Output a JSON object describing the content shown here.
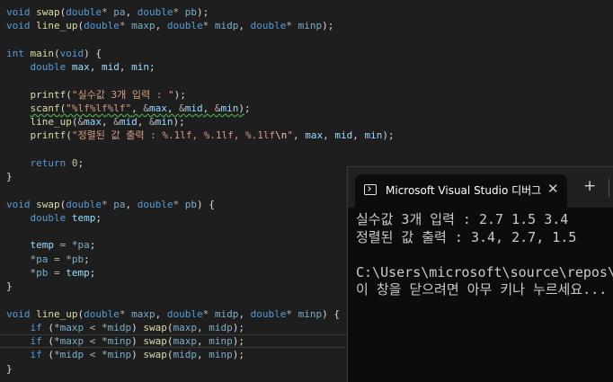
{
  "editor": {
    "lines": [
      {
        "current": false,
        "tokens": [
          [
            "kw",
            "void"
          ],
          [
            "pu",
            " "
          ],
          [
            "fn",
            "swap"
          ],
          [
            "pu",
            "("
          ],
          [
            "ty",
            "double"
          ],
          [
            "op",
            "*"
          ],
          [
            "pu",
            " "
          ],
          [
            "pm",
            "pa"
          ],
          [
            "pu",
            ", "
          ],
          [
            "ty",
            "double"
          ],
          [
            "op",
            "*"
          ],
          [
            "pu",
            " "
          ],
          [
            "pm",
            "pb"
          ],
          [
            "pu",
            ");"
          ]
        ]
      },
      {
        "current": false,
        "tokens": [
          [
            "kw",
            "void"
          ],
          [
            "pu",
            " "
          ],
          [
            "fn",
            "line_up"
          ],
          [
            "pu",
            "("
          ],
          [
            "ty",
            "double"
          ],
          [
            "op",
            "*"
          ],
          [
            "pu",
            " "
          ],
          [
            "pm",
            "maxp"
          ],
          [
            "pu",
            ", "
          ],
          [
            "ty",
            "double"
          ],
          [
            "op",
            "*"
          ],
          [
            "pu",
            " "
          ],
          [
            "pm",
            "midp"
          ],
          [
            "pu",
            ", "
          ],
          [
            "ty",
            "double"
          ],
          [
            "op",
            "*"
          ],
          [
            "pu",
            " "
          ],
          [
            "pm",
            "minp"
          ],
          [
            "pu",
            ");"
          ]
        ]
      },
      {
        "current": false,
        "tokens": []
      },
      {
        "current": false,
        "tokens": [
          [
            "kw",
            "int"
          ],
          [
            "pu",
            " "
          ],
          [
            "fn",
            "main"
          ],
          [
            "pu",
            "("
          ],
          [
            "kw",
            "void"
          ],
          [
            "pu",
            ") {"
          ]
        ]
      },
      {
        "current": false,
        "tokens": [
          [
            "pu",
            "    "
          ],
          [
            "ty",
            "double"
          ],
          [
            "pu",
            " "
          ],
          [
            "lv",
            "max"
          ],
          [
            "pu",
            ", "
          ],
          [
            "lv",
            "mid"
          ],
          [
            "pu",
            ", "
          ],
          [
            "lv",
            "min"
          ],
          [
            "pu",
            ";"
          ]
        ]
      },
      {
        "current": false,
        "tokens": []
      },
      {
        "current": false,
        "tokens": [
          [
            "pu",
            "    "
          ],
          [
            "fn",
            "printf"
          ],
          [
            "pu",
            "("
          ],
          [
            "str",
            "\"실수값 3개 입력 : \""
          ],
          [
            "pu",
            ");"
          ]
        ]
      },
      {
        "current": false,
        "tokens": [
          [
            "pu",
            "    "
          ],
          [
            "fn squig",
            "scanf"
          ],
          [
            "pu squig",
            "("
          ],
          [
            "str squig",
            "\"%lf%lf%lf\""
          ],
          [
            "pu squig",
            ", "
          ],
          [
            "op squig",
            "&"
          ],
          [
            "lv squig",
            "max"
          ],
          [
            "pu squig",
            ", "
          ],
          [
            "op squig",
            "&"
          ],
          [
            "lv squig",
            "mid"
          ],
          [
            "pu squig",
            ", "
          ],
          [
            "op squig",
            "&"
          ],
          [
            "lv squig",
            "min"
          ],
          [
            "pu squig",
            ")"
          ],
          [
            "pu",
            ";"
          ]
        ]
      },
      {
        "current": false,
        "tokens": [
          [
            "pu",
            "    "
          ],
          [
            "fn",
            "line_up"
          ],
          [
            "pu",
            "("
          ],
          [
            "op",
            "&"
          ],
          [
            "lv",
            "max"
          ],
          [
            "pu",
            ", "
          ],
          [
            "op",
            "&"
          ],
          [
            "lv",
            "mid"
          ],
          [
            "pu",
            ", "
          ],
          [
            "op",
            "&"
          ],
          [
            "lv",
            "min"
          ],
          [
            "pu",
            ");"
          ]
        ]
      },
      {
        "current": false,
        "tokens": [
          [
            "pu",
            "    "
          ],
          [
            "fn",
            "printf"
          ],
          [
            "pu",
            "("
          ],
          [
            "str",
            "\"정렬된 값 출력 : %.1lf, %.1lf, %.1lf"
          ],
          [
            "esc",
            "\\n"
          ],
          [
            "str",
            "\""
          ],
          [
            "pu",
            ", "
          ],
          [
            "lv",
            "max"
          ],
          [
            "pu",
            ", "
          ],
          [
            "lv",
            "mid"
          ],
          [
            "pu",
            ", "
          ],
          [
            "lv",
            "min"
          ],
          [
            "pu",
            ");"
          ]
        ]
      },
      {
        "current": false,
        "tokens": []
      },
      {
        "current": false,
        "tokens": [
          [
            "pu",
            "    "
          ],
          [
            "kw",
            "return"
          ],
          [
            "pu",
            " "
          ],
          [
            "num",
            "0"
          ],
          [
            "pu",
            ";"
          ]
        ]
      },
      {
        "current": false,
        "tokens": [
          [
            "pu",
            "}"
          ]
        ]
      },
      {
        "current": false,
        "tokens": []
      },
      {
        "current": false,
        "tokens": [
          [
            "kw",
            "void"
          ],
          [
            "pu",
            " "
          ],
          [
            "fn",
            "swap"
          ],
          [
            "pu",
            "("
          ],
          [
            "ty",
            "double"
          ],
          [
            "op",
            "*"
          ],
          [
            "pu",
            " "
          ],
          [
            "pm",
            "pa"
          ],
          [
            "pu",
            ", "
          ],
          [
            "ty",
            "double"
          ],
          [
            "op",
            "*"
          ],
          [
            "pu",
            " "
          ],
          [
            "pm",
            "pb"
          ],
          [
            "pu",
            ") {"
          ]
        ]
      },
      {
        "current": false,
        "tokens": [
          [
            "pu",
            "    "
          ],
          [
            "ty",
            "double"
          ],
          [
            "pu",
            " "
          ],
          [
            "lv",
            "temp"
          ],
          [
            "pu",
            ";"
          ]
        ]
      },
      {
        "current": false,
        "tokens": []
      },
      {
        "current": false,
        "tokens": [
          [
            "pu",
            "    "
          ],
          [
            "lv",
            "temp"
          ],
          [
            "pu",
            " "
          ],
          [
            "op",
            "="
          ],
          [
            "pu",
            " "
          ],
          [
            "op",
            "*"
          ],
          [
            "pm",
            "pa"
          ],
          [
            "pu",
            ";"
          ]
        ]
      },
      {
        "current": false,
        "tokens": [
          [
            "pu",
            "    "
          ],
          [
            "op",
            "*"
          ],
          [
            "pm",
            "pa"
          ],
          [
            "pu",
            " "
          ],
          [
            "op",
            "="
          ],
          [
            "pu",
            " "
          ],
          [
            "op",
            "*"
          ],
          [
            "pm",
            "pb"
          ],
          [
            "pu",
            ";"
          ]
        ]
      },
      {
        "current": false,
        "tokens": [
          [
            "pu",
            "    "
          ],
          [
            "op",
            "*"
          ],
          [
            "pm",
            "pb"
          ],
          [
            "pu",
            " "
          ],
          [
            "op",
            "="
          ],
          [
            "pu",
            " "
          ],
          [
            "lv",
            "temp"
          ],
          [
            "pu",
            ";"
          ]
        ]
      },
      {
        "current": false,
        "tokens": [
          [
            "pu",
            "}"
          ]
        ]
      },
      {
        "current": false,
        "tokens": []
      },
      {
        "current": false,
        "tokens": [
          [
            "kw",
            "void"
          ],
          [
            "pu",
            " "
          ],
          [
            "fn",
            "line_up"
          ],
          [
            "pu",
            "("
          ],
          [
            "ty",
            "double"
          ],
          [
            "op",
            "*"
          ],
          [
            "pu",
            " "
          ],
          [
            "pm",
            "maxp"
          ],
          [
            "pu",
            ", "
          ],
          [
            "ty",
            "double"
          ],
          [
            "op",
            "*"
          ],
          [
            "pu",
            " "
          ],
          [
            "pm",
            "midp"
          ],
          [
            "pu",
            ", "
          ],
          [
            "ty",
            "double"
          ],
          [
            "op",
            "*"
          ],
          [
            "pu",
            " "
          ],
          [
            "pm",
            "minp"
          ],
          [
            "pu",
            ") {"
          ]
        ]
      },
      {
        "current": false,
        "tokens": [
          [
            "pu",
            "    "
          ],
          [
            "kw",
            "if"
          ],
          [
            "pu",
            " ("
          ],
          [
            "op",
            "*"
          ],
          [
            "pm",
            "maxp"
          ],
          [
            "pu",
            " "
          ],
          [
            "op",
            "<"
          ],
          [
            "pu",
            " "
          ],
          [
            "op",
            "*"
          ],
          [
            "pm",
            "midp"
          ],
          [
            "pu",
            ") "
          ],
          [
            "fn",
            "swap"
          ],
          [
            "pu",
            "("
          ],
          [
            "pm",
            "maxp"
          ],
          [
            "pu",
            ", "
          ],
          [
            "pm",
            "midp"
          ],
          [
            "pu",
            ");"
          ]
        ]
      },
      {
        "current": true,
        "tokens": [
          [
            "pu",
            "    "
          ],
          [
            "kw",
            "if"
          ],
          [
            "pu",
            " ("
          ],
          [
            "op",
            "*"
          ],
          [
            "pm",
            "maxp"
          ],
          [
            "pu",
            " "
          ],
          [
            "op",
            "<"
          ],
          [
            "pu",
            " "
          ],
          [
            "op",
            "*"
          ],
          [
            "pm",
            "minp"
          ],
          [
            "pu",
            ") "
          ],
          [
            "fn",
            "swap"
          ],
          [
            "pu",
            "("
          ],
          [
            "pm",
            "maxp"
          ],
          [
            "pu",
            ", "
          ],
          [
            "pm",
            "minp"
          ],
          [
            "pu",
            ");"
          ]
        ]
      },
      {
        "current": false,
        "tokens": [
          [
            "pu",
            "    "
          ],
          [
            "kw",
            "if"
          ],
          [
            "pu",
            " ("
          ],
          [
            "op",
            "*"
          ],
          [
            "pm",
            "midp"
          ],
          [
            "pu",
            " "
          ],
          [
            "op",
            "<"
          ],
          [
            "pu",
            " "
          ],
          [
            "op",
            "*"
          ],
          [
            "pm",
            "minp"
          ],
          [
            "pu",
            ") "
          ],
          [
            "fn",
            "swap"
          ],
          [
            "pu",
            "("
          ],
          [
            "pm",
            "midp"
          ],
          [
            "pu",
            ", "
          ],
          [
            "pm",
            "minp"
          ],
          [
            "pu",
            ");"
          ]
        ]
      },
      {
        "current": false,
        "tokens": [
          [
            "pu",
            "}"
          ]
        ]
      }
    ]
  },
  "console": {
    "tab_title": "Microsoft Visual Studio 디버그",
    "close_symbol": "✕",
    "new_tab_symbol": "+",
    "tab_icon": "terminal-icon",
    "output_lines": [
      "실수값 3개 입력 : 2.7 1.5 3.4",
      "정렬된 값 출력 : 3.4, 2.7, 1.5",
      "",
      "C:\\Users\\microsoft\\source\\repos\\",
      "이 창을 닫으려면 아무 키나 누르세요..."
    ]
  }
}
